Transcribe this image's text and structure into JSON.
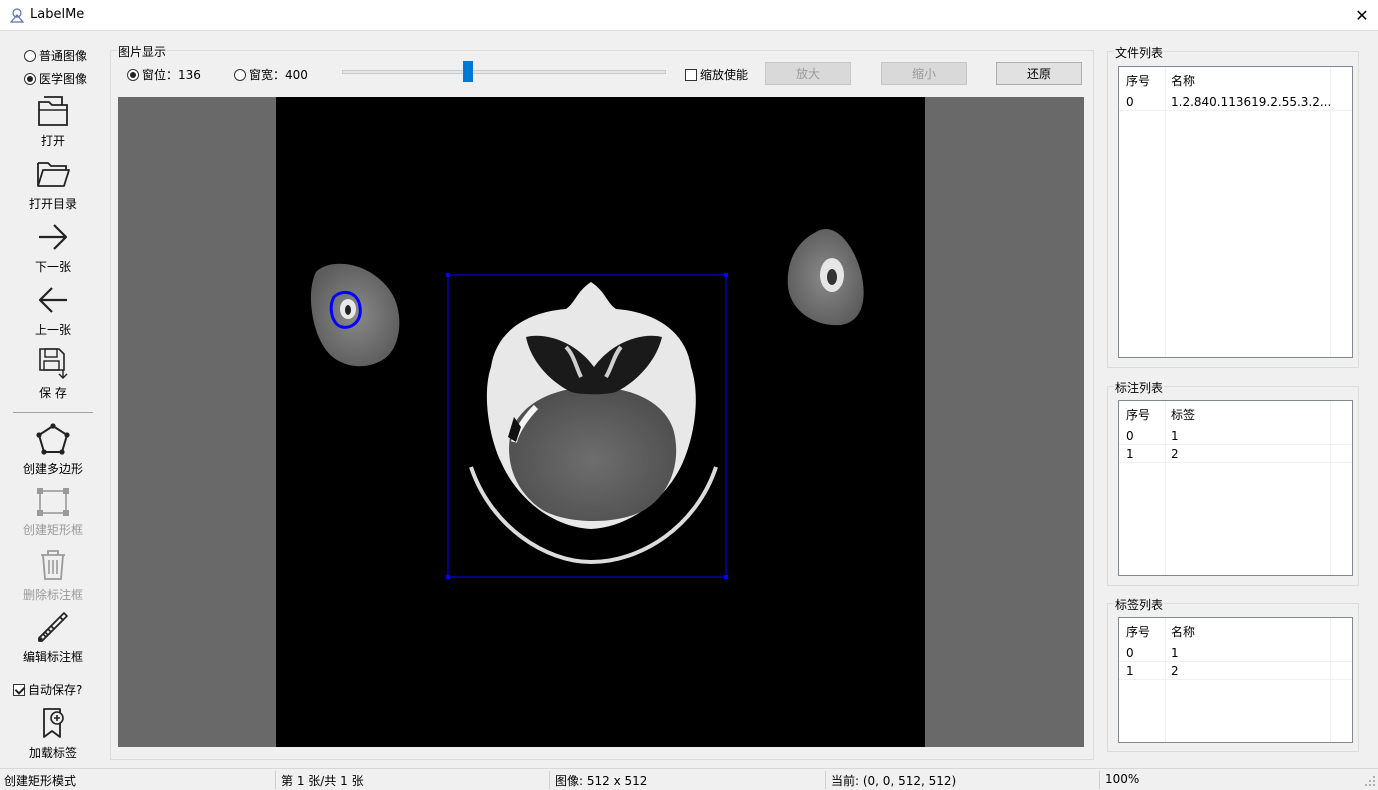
{
  "window": {
    "title": "LabelMe",
    "close_glyph": "✕"
  },
  "toolbar": {
    "mode_normal": "普通图像",
    "mode_medical": "医学图像",
    "open": "打开",
    "open_dir": "打开目录",
    "next": "下一张",
    "prev": "上一张",
    "save": "保  存",
    "create_polygon": "创建多边形",
    "create_rect": "创建矩形框",
    "delete_box": "删除标注框",
    "edit_box": "编辑标注框",
    "auto_save": "自动保存?",
    "load_labels": "加载标签"
  },
  "display": {
    "group_title": "图片显示",
    "window_level_label": "窗位",
    "window_level_value": "窗位：136",
    "window_width_value": "窗宽：400",
    "window_level_slider": 0.39,
    "zoom_enable": "缩放使能",
    "zoom_in": "放大",
    "zoom_out": "缩小",
    "reset": "还原"
  },
  "file_list": {
    "title": "文件列表",
    "headers": [
      "序号",
      "名称"
    ],
    "rows": [
      {
        "idx": "0",
        "name": "1.2.840.113619.2.55.3.2..."
      }
    ]
  },
  "annotation_list": {
    "title": "标注列表",
    "headers": [
      "序号",
      "标签"
    ],
    "rows": [
      {
        "idx": "0",
        "name": "1"
      },
      {
        "idx": "1",
        "name": "2"
      }
    ]
  },
  "label_list": {
    "title": "标签列表",
    "headers": [
      "序号",
      "名称"
    ],
    "rows": [
      {
        "idx": "0",
        "name": "1"
      },
      {
        "idx": "1",
        "name": "2"
      }
    ]
  },
  "status": {
    "mode": "创建矩形模式",
    "page": "第 1 张/共 1 张",
    "image_size": "图像: 512 x 512",
    "current": "当前: (0, 0, 512, 512)",
    "zoom": "100%"
  },
  "colors": {
    "accent": "#0078d7",
    "annotation": "#0000ff",
    "viewer_bg": "#696969"
  }
}
